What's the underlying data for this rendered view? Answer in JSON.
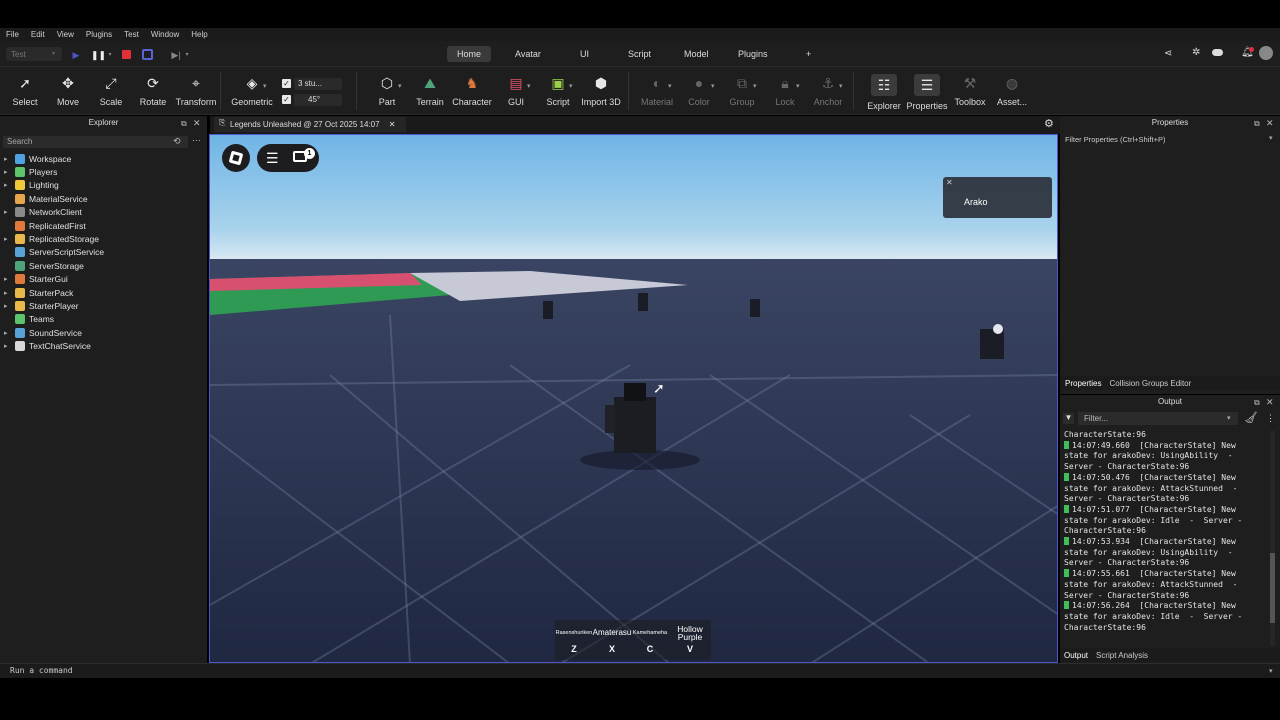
{
  "menu": [
    "File",
    "Edit",
    "View",
    "Plugins",
    "Test",
    "Window",
    "Help"
  ],
  "mode_select": "Test",
  "tabs": [
    "Home",
    "Avatar",
    "UI",
    "Script",
    "Model",
    "Plugins",
    "+"
  ],
  "tools": {
    "select": "Select",
    "move": "Move",
    "scale": "Scale",
    "rotate": "Rotate",
    "transform": "Transform",
    "geometric": "Geometric",
    "part": "Part",
    "terrain": "Terrain",
    "character": "Character",
    "gui": "GUI",
    "script": "Script",
    "import3d": "Import 3D",
    "material": "Material",
    "color": "Color",
    "group": "Group",
    "lock": "Lock",
    "anchor": "Anchor",
    "explorer": "Explorer",
    "properties": "Properties",
    "toolbox": "Toolbox",
    "asset": "Asset..."
  },
  "snap": {
    "move": "3 stu...",
    "rotate": "45°"
  },
  "explorer": {
    "title": "Explorer",
    "search_placeholder": "Search",
    "items": [
      {
        "label": "Workspace",
        "color": "#4fa3e0",
        "arrow": true
      },
      {
        "label": "Players",
        "color": "#5cc46a",
        "arrow": true
      },
      {
        "label": "Lighting",
        "color": "#f0c93a",
        "arrow": true
      },
      {
        "label": "MaterialService",
        "color": "#e6a54a",
        "arrow": false
      },
      {
        "label": "NetworkClient",
        "color": "#8a8a8a",
        "arrow": true
      },
      {
        "label": "ReplicatedFirst",
        "color": "#e07a3c",
        "arrow": false
      },
      {
        "label": "ReplicatedStorage",
        "color": "#e8b94a",
        "arrow": true
      },
      {
        "label": "ServerScriptService",
        "color": "#59a2d8",
        "arrow": false
      },
      {
        "label": "ServerStorage",
        "color": "#4fa37a",
        "arrow": false
      },
      {
        "label": "StarterGui",
        "color": "#e07a3c",
        "arrow": true
      },
      {
        "label": "StarterPack",
        "color": "#e8b94a",
        "arrow": true
      },
      {
        "label": "StarterPlayer",
        "color": "#e8b94a",
        "arrow": true
      },
      {
        "label": "Teams",
        "color": "#5cc46a",
        "arrow": false
      },
      {
        "label": "SoundService",
        "color": "#59a2d8",
        "arrow": true
      },
      {
        "label": "TextChatService",
        "color": "#d8d8d8",
        "arrow": true
      }
    ]
  },
  "viewport": {
    "tab_title": "Legends Unleashed @ 27 Oct 2025 14:07",
    "player_name": "Arako",
    "chat_badge": "1",
    "hotbar": [
      {
        "name": "Rasenshuriken",
        "key": "Z"
      },
      {
        "name": "Amaterasu",
        "key": "X"
      },
      {
        "name": "Kamehameha",
        "key": "C"
      },
      {
        "name": "Hollow Purple",
        "key": "V"
      }
    ]
  },
  "properties": {
    "title": "Properties",
    "filter": "Filter Properties (Ctrl+Shift+P)",
    "tabs": [
      "Properties",
      "Collision Groups Editor"
    ]
  },
  "output": {
    "title": "Output",
    "filter_placeholder": "Filter...",
    "tabs": [
      "Output",
      "Script Analysis"
    ],
    "lines": [
      {
        "bar": false,
        "text": "CharacterState:96"
      },
      {
        "bar": true,
        "text": "14:07:49.660  [CharacterState] New"
      },
      {
        "bar": false,
        "text": "state for arakoDev: UsingAbility  -"
      },
      {
        "bar": false,
        "text": "Server - CharacterState:96"
      },
      {
        "bar": true,
        "text": "14:07:50.476  [CharacterState] New"
      },
      {
        "bar": false,
        "text": "state for arakoDev: AttackStunned  -"
      },
      {
        "bar": false,
        "text": "Server - CharacterState:96"
      },
      {
        "bar": true,
        "text": "14:07:51.077  [CharacterState] New"
      },
      {
        "bar": false,
        "text": "state for arakoDev: Idle  -  Server -"
      },
      {
        "bar": false,
        "text": "CharacterState:96"
      },
      {
        "bar": true,
        "text": "14:07:53.934  [CharacterState] New"
      },
      {
        "bar": false,
        "text": "state for arakoDev: UsingAbility  -"
      },
      {
        "bar": false,
        "text": "Server - CharacterState:96"
      },
      {
        "bar": true,
        "text": "14:07:55.661  [CharacterState] New"
      },
      {
        "bar": false,
        "text": "state for arakoDev: AttackStunned  -"
      },
      {
        "bar": false,
        "text": "Server - CharacterState:96"
      },
      {
        "bar": true,
        "text": "14:07:56.264  [CharacterState] New"
      },
      {
        "bar": false,
        "text": "state for arakoDev: Idle  -  Server -"
      },
      {
        "bar": false,
        "text": "CharacterState:96"
      }
    ]
  },
  "command_bar": "Run a command"
}
